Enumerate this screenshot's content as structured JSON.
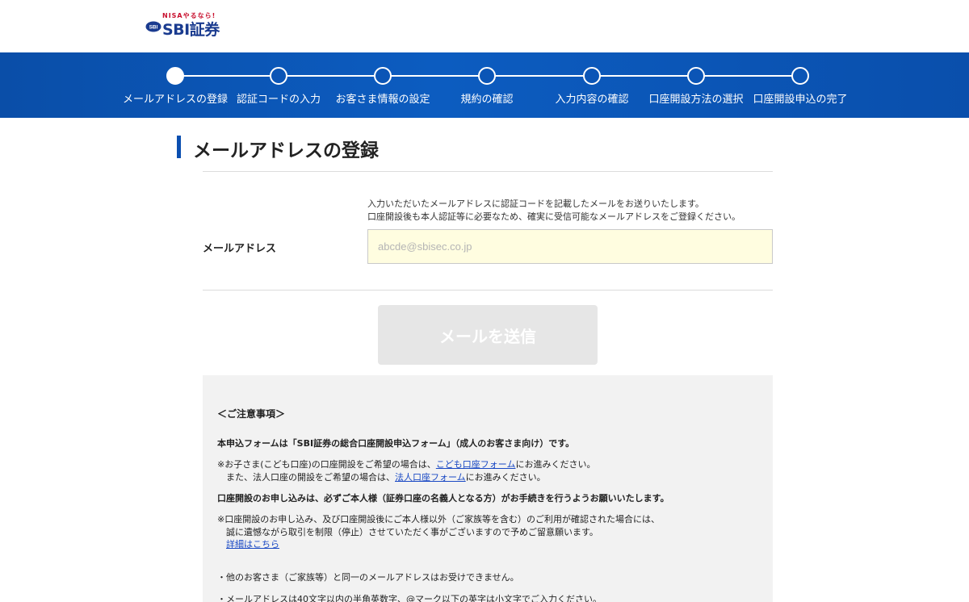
{
  "header": {
    "logo_tagline": "NISAやるなら!",
    "logo_text": "SBI証券",
    "logo_badge": "SBI"
  },
  "steps": [
    {
      "label": "メールアドレスの登録",
      "active": true
    },
    {
      "label": "認証コードの入力",
      "active": false
    },
    {
      "label": "お客さま情報の設定",
      "active": false
    },
    {
      "label": "規約の確認",
      "active": false
    },
    {
      "label": "入力内容の確認",
      "active": false
    },
    {
      "label": "口座開設方法の選択",
      "active": false
    },
    {
      "label": "口座開設申込の完了",
      "active": false
    }
  ],
  "page": {
    "title": "メールアドレスの登録"
  },
  "form": {
    "help_line1": "入力いただいたメールアドレスに認証コードを記載したメールをお送りいたします。",
    "help_line2": "口座開設後も本人認証等に必要なため、確実に受信可能なメールアドレスをご登録ください。",
    "email_label": "メールアドレス",
    "email_placeholder": "abcde@sbisec.co.jp",
    "email_value": "",
    "send_button": "メールを送信"
  },
  "notice": {
    "heading": "＜ご注意事項＞",
    "form_notice": "本申込フォームは「SBI証券の総合口座開設申込フォーム」（成人のお客さま向け）です。",
    "child_prefix": "※お子さま(こども口座)の口座開設をご希望の場合は、",
    "child_link": "こども口座フォーム",
    "child_suffix": "にお進みください。",
    "corp_prefix": "また、法人口座の開設をご希望の場合は、",
    "corp_link": "法人口座フォーム",
    "corp_suffix": "にお進みください。",
    "self_notice": "口座開設のお申し込みは、必ずご本人様（証券口座の名義人となる方）がお手続きを行うようお願いいたします。",
    "restrict_line1": "※口座開設のお申し込み、及び口座開設後にご本人様以外（ご家族等を含む）のご利用が確認された場合には、",
    "restrict_line2": "誠に遺憾ながら取引を制限（停止）させていただく事がございますので予めご留意願います。",
    "details_link": "詳細はこちら",
    "bullet1": "・他のお客さま（ご家族等）と同一のメールアドレスはお受けできません。",
    "bullet2": "・メールアドレスは40文字以内の半角英数字、@マーク以下の英字は小文字でご入力ください。"
  },
  "colors": {
    "brand_blue": "#0b55b6",
    "input_bg": "#fffde0",
    "button_disabled": "#e6e6e6",
    "link": "#1a49c4"
  }
}
